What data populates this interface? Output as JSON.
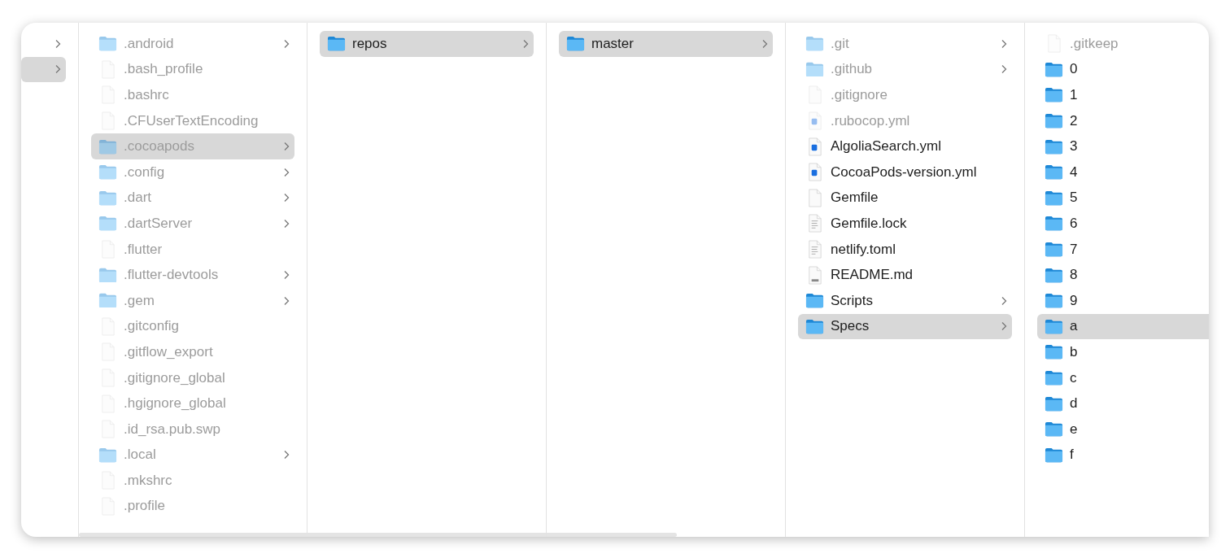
{
  "columns": [
    {
      "items": [
        {
          "selected": false,
          "expandable": true
        },
        {
          "selected": true,
          "expandable": true
        }
      ]
    },
    {
      "items": [
        {
          "name": ".android",
          "kind": "folder",
          "hidden": true,
          "expandable": true,
          "selected": false
        },
        {
          "name": ".bash_profile",
          "kind": "file",
          "hidden": true,
          "expandable": false,
          "selected": false
        },
        {
          "name": ".bashrc",
          "kind": "file",
          "hidden": true,
          "expandable": false,
          "selected": false
        },
        {
          "name": ".CFUserTextEncoding",
          "kind": "file",
          "hidden": true,
          "expandable": false,
          "selected": false
        },
        {
          "name": ".cocoapods",
          "kind": "folder",
          "hidden": true,
          "expandable": true,
          "selected": true
        },
        {
          "name": ".config",
          "kind": "folder",
          "hidden": true,
          "expandable": true,
          "selected": false
        },
        {
          "name": ".dart",
          "kind": "folder",
          "hidden": true,
          "expandable": true,
          "selected": false
        },
        {
          "name": ".dartServer",
          "kind": "folder",
          "hidden": true,
          "expandable": true,
          "selected": false
        },
        {
          "name": ".flutter",
          "kind": "file",
          "hidden": true,
          "expandable": false,
          "selected": false
        },
        {
          "name": ".flutter-devtools",
          "kind": "folder",
          "hidden": true,
          "expandable": true,
          "selected": false
        },
        {
          "name": ".gem",
          "kind": "folder",
          "hidden": true,
          "expandable": true,
          "selected": false
        },
        {
          "name": ".gitconfig",
          "kind": "file",
          "hidden": true,
          "expandable": false,
          "selected": false
        },
        {
          "name": ".gitflow_export",
          "kind": "file",
          "hidden": true,
          "expandable": false,
          "selected": false
        },
        {
          "name": ".gitignore_global",
          "kind": "file",
          "hidden": true,
          "expandable": false,
          "selected": false
        },
        {
          "name": ".hgignore_global",
          "kind": "file",
          "hidden": true,
          "expandable": false,
          "selected": false
        },
        {
          "name": ".id_rsa.pub.swp",
          "kind": "file",
          "hidden": true,
          "expandable": false,
          "selected": false
        },
        {
          "name": ".local",
          "kind": "folder",
          "hidden": true,
          "expandable": true,
          "selected": false
        },
        {
          "name": ".mkshrc",
          "kind": "file",
          "hidden": true,
          "expandable": false,
          "selected": false
        },
        {
          "name": ".profile",
          "kind": "file",
          "hidden": true,
          "expandable": false,
          "selected": false
        }
      ]
    },
    {
      "items": [
        {
          "name": "repos",
          "kind": "folder",
          "hidden": false,
          "expandable": true,
          "selected": true
        }
      ]
    },
    {
      "items": [
        {
          "name": "master",
          "kind": "folder",
          "hidden": false,
          "expandable": true,
          "selected": true
        }
      ]
    },
    {
      "items": [
        {
          "name": ".git",
          "kind": "folder",
          "hidden": true,
          "expandable": true,
          "selected": false
        },
        {
          "name": ".github",
          "kind": "folder",
          "hidden": true,
          "expandable": true,
          "selected": false
        },
        {
          "name": ".gitignore",
          "kind": "file",
          "hidden": true,
          "expandable": false,
          "selected": false
        },
        {
          "name": ".rubocop.yml",
          "kind": "yml",
          "hidden": true,
          "expandable": false,
          "selected": false
        },
        {
          "name": "AlgoliaSearch.yml",
          "kind": "yml",
          "hidden": false,
          "expandable": false,
          "selected": false
        },
        {
          "name": "CocoaPods-version.yml",
          "kind": "yml",
          "hidden": false,
          "expandable": false,
          "selected": false
        },
        {
          "name": "Gemfile",
          "kind": "file",
          "hidden": false,
          "expandable": false,
          "selected": false
        },
        {
          "name": "Gemfile.lock",
          "kind": "text",
          "hidden": false,
          "expandable": false,
          "selected": false
        },
        {
          "name": "netlify.toml",
          "kind": "text",
          "hidden": false,
          "expandable": false,
          "selected": false
        },
        {
          "name": "README.md",
          "kind": "md",
          "hidden": false,
          "expandable": false,
          "selected": false
        },
        {
          "name": "Scripts",
          "kind": "folder",
          "hidden": false,
          "expandable": true,
          "selected": false
        },
        {
          "name": "Specs",
          "kind": "folder",
          "hidden": false,
          "expandable": true,
          "selected": true
        }
      ]
    },
    {
      "items": [
        {
          "name": ".gitkeep",
          "kind": "file",
          "hidden": true,
          "expandable": false,
          "selected": false
        },
        {
          "name": "0",
          "kind": "folder",
          "hidden": false,
          "expandable": false,
          "selected": false
        },
        {
          "name": "1",
          "kind": "folder",
          "hidden": false,
          "expandable": false,
          "selected": false
        },
        {
          "name": "2",
          "kind": "folder",
          "hidden": false,
          "expandable": false,
          "selected": false
        },
        {
          "name": "3",
          "kind": "folder",
          "hidden": false,
          "expandable": false,
          "selected": false
        },
        {
          "name": "4",
          "kind": "folder",
          "hidden": false,
          "expandable": false,
          "selected": false
        },
        {
          "name": "5",
          "kind": "folder",
          "hidden": false,
          "expandable": false,
          "selected": false
        },
        {
          "name": "6",
          "kind": "folder",
          "hidden": false,
          "expandable": false,
          "selected": false
        },
        {
          "name": "7",
          "kind": "folder",
          "hidden": false,
          "expandable": false,
          "selected": false
        },
        {
          "name": "8",
          "kind": "folder",
          "hidden": false,
          "expandable": false,
          "selected": false
        },
        {
          "name": "9",
          "kind": "folder",
          "hidden": false,
          "expandable": false,
          "selected": false
        },
        {
          "name": "a",
          "kind": "folder",
          "hidden": false,
          "expandable": false,
          "selected": true
        },
        {
          "name": "b",
          "kind": "folder",
          "hidden": false,
          "expandable": false,
          "selected": false
        },
        {
          "name": "c",
          "kind": "folder",
          "hidden": false,
          "expandable": false,
          "selected": false
        },
        {
          "name": "d",
          "kind": "folder",
          "hidden": false,
          "expandable": false,
          "selected": false
        },
        {
          "name": "e",
          "kind": "folder",
          "hidden": false,
          "expandable": false,
          "selected": false
        },
        {
          "name": "f",
          "kind": "folder",
          "hidden": false,
          "expandable": false,
          "selected": false
        }
      ]
    }
  ]
}
